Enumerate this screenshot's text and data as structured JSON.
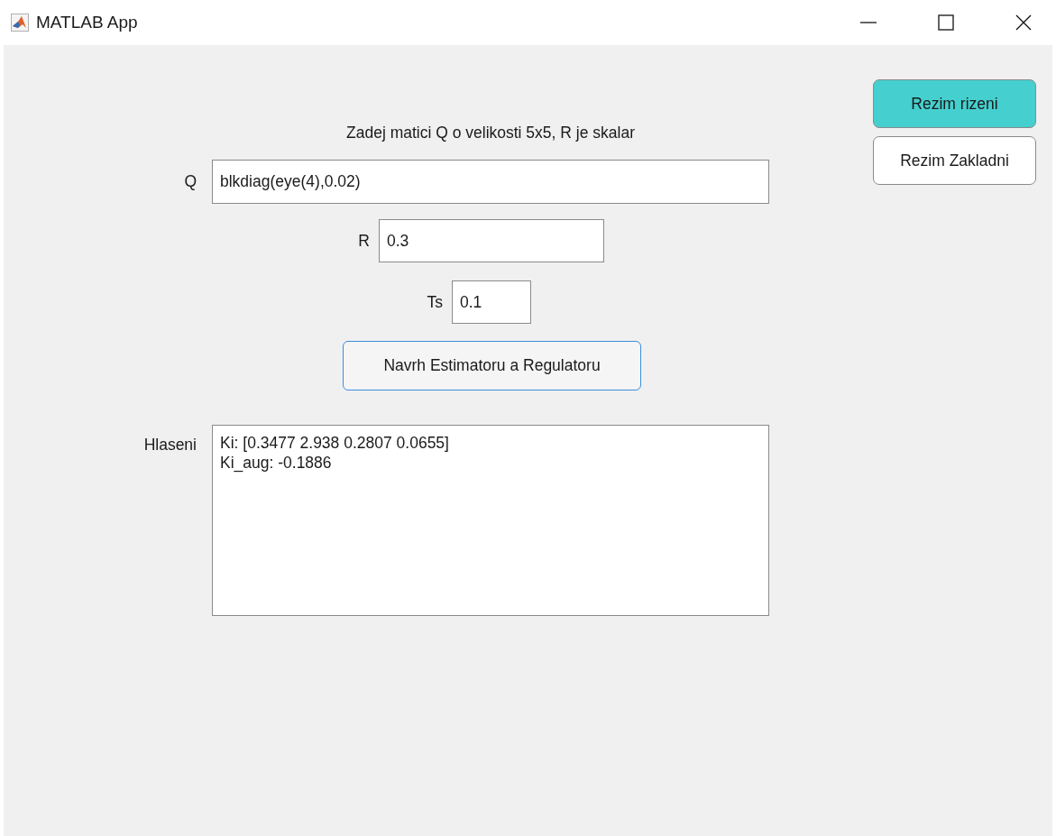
{
  "window": {
    "title": "MATLAB App"
  },
  "heading": "Zadej matici Q o velikosti 5x5, R je skalar",
  "fields": [
    {
      "label": "Q",
      "value": "blkdiag(eye(4),0.02)"
    },
    {
      "label": "R",
      "value": "0.3"
    },
    {
      "label": "Ts",
      "value": "0.1"
    }
  ],
  "action_button": "Navrh Estimatoru a Regulatoru",
  "messages": {
    "label": "Hlaseni",
    "lines": [
      "Ki: [0.3477 2.938 0.2807 0.0655]",
      "Ki_aug: -0.1886"
    ]
  },
  "mode_buttons": [
    {
      "label": "Rezim rizeni",
      "selected": true
    },
    {
      "label": "Rezim Zakladni",
      "selected": false
    }
  ]
}
